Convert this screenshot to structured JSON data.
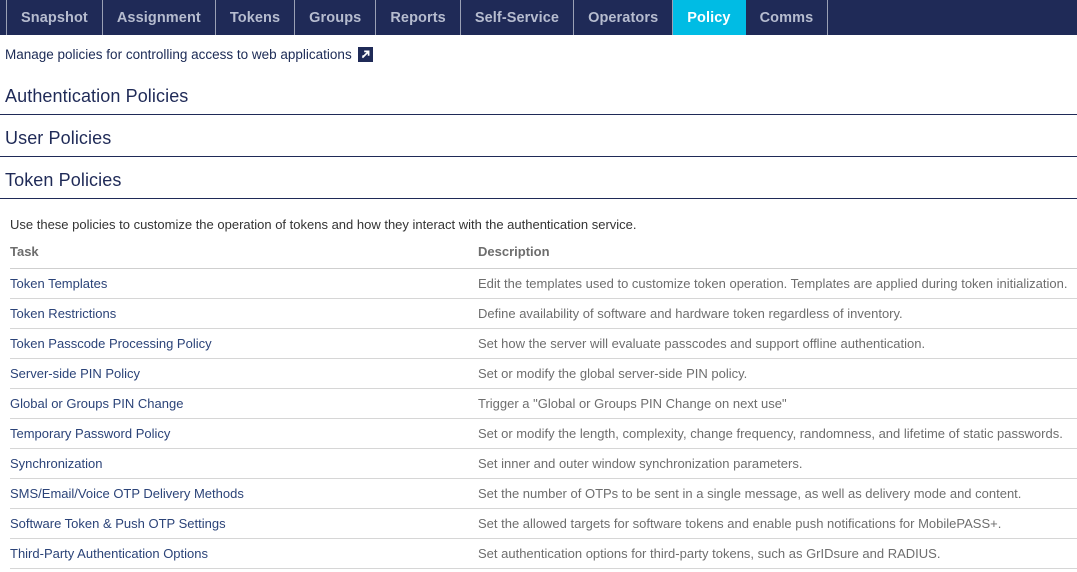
{
  "nav": {
    "tabs": [
      {
        "label": "Snapshot",
        "active": false
      },
      {
        "label": "Assignment",
        "active": false
      },
      {
        "label": "Tokens",
        "active": false
      },
      {
        "label": "Groups",
        "active": false
      },
      {
        "label": "Reports",
        "active": false
      },
      {
        "label": "Self-Service",
        "active": false
      },
      {
        "label": "Operators",
        "active": false
      },
      {
        "label": "Policy",
        "active": true
      },
      {
        "label": "Comms",
        "active": false
      }
    ],
    "active_tab": "Policy",
    "background_color": "#1f2a57",
    "active_color": "#00bce4",
    "label_color": "#b6bccf"
  },
  "subtitle": {
    "text": "Manage policies for controlling access to web applications",
    "icon": "external-link-icon"
  },
  "sections": [
    {
      "title": "Authentication Policies"
    },
    {
      "title": "User Policies"
    },
    {
      "title": "Token Policies"
    }
  ],
  "token_policies": {
    "intro": "Use these policies to customize the operation of tokens and how they interact with the authentication service.",
    "columns": [
      "Task",
      "Description"
    ],
    "rows": [
      {
        "task": "Token Templates",
        "description": "Edit the templates used to customize token operation. Templates are applied during token initialization."
      },
      {
        "task": "Token Restrictions",
        "description": "Define availability of software and hardware token regardless of inventory."
      },
      {
        "task": "Token Passcode Processing Policy",
        "description": "Set how the server will evaluate passcodes and support offline authentication."
      },
      {
        "task": "Server-side PIN Policy",
        "description": "Set or modify the global server-side PIN policy."
      },
      {
        "task": "Global or Groups PIN Change",
        "description": "Trigger a \"Global or Groups PIN Change on next use\""
      },
      {
        "task": "Temporary Password Policy",
        "description": "Set or modify the length, complexity, change frequency, randomness, and lifetime of static passwords."
      },
      {
        "task": "Synchronization",
        "description": "Set inner and outer window synchronization parameters."
      },
      {
        "task": "SMS/Email/Voice OTP Delivery Methods",
        "description": "Set the number of OTPs to be sent in a single message, as well as delivery mode and content."
      },
      {
        "task": "Software Token & Push OTP Settings",
        "description": "Set the allowed targets for software tokens and enable push notifications for MobilePASS+."
      },
      {
        "task": "Third-Party Authentication Options",
        "description": "Set authentication options for third-party tokens, such as GrIDsure and RADIUS."
      }
    ]
  }
}
